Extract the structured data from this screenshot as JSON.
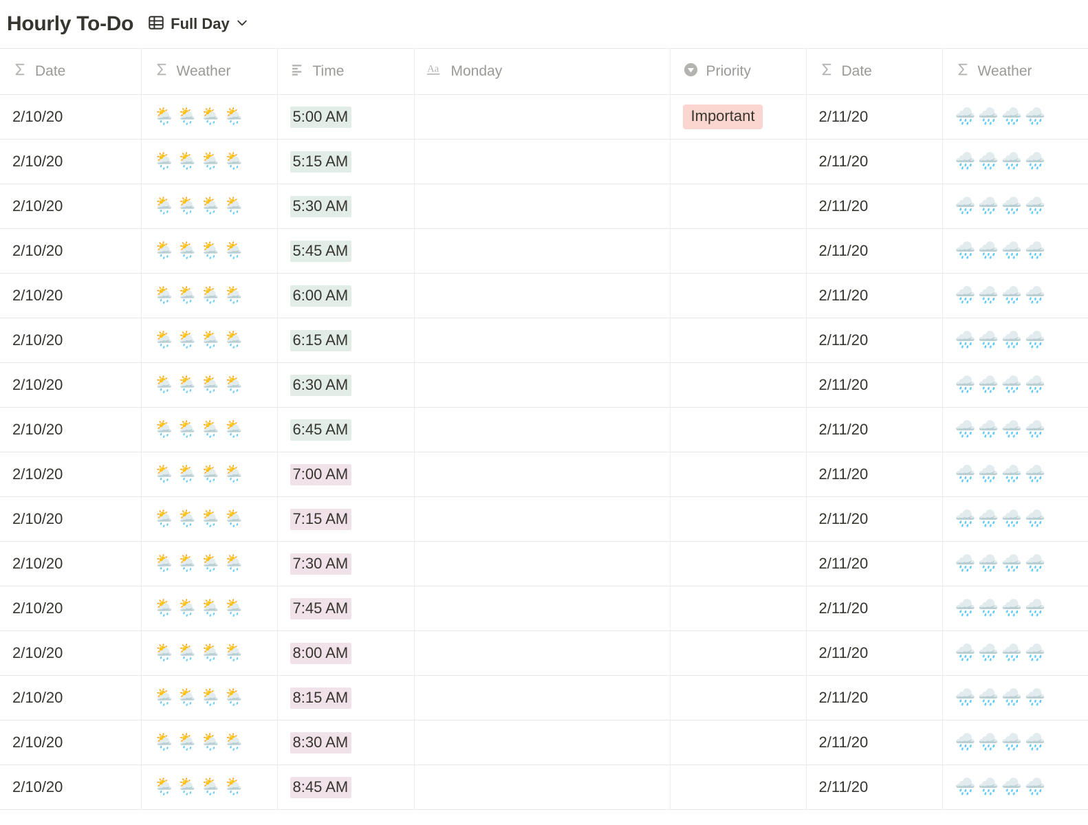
{
  "header": {
    "title": "Hourly To-Do",
    "view_icon": "table-icon",
    "view_label": "Full Day",
    "chevron_icon": "chevron-down-icon"
  },
  "table": {
    "columns": [
      {
        "id": "date_left",
        "label": "Date",
        "icon": "sigma-icon",
        "type": "formula"
      },
      {
        "id": "weather_left",
        "label": "Weather",
        "icon": "sigma-icon",
        "type": "formula"
      },
      {
        "id": "time",
        "label": "Time",
        "icon": "text-lines-icon",
        "type": "text"
      },
      {
        "id": "monday",
        "label": "Monday",
        "icon": "aa-icon",
        "type": "title"
      },
      {
        "id": "priority",
        "label": "Priority",
        "icon": "select-icon",
        "type": "select"
      },
      {
        "id": "date_right",
        "label": "Date",
        "icon": "sigma-icon",
        "type": "formula"
      },
      {
        "id": "weather_right",
        "label": "Weather",
        "icon": "sigma-icon",
        "type": "formula"
      }
    ],
    "highlight_colors": {
      "green": "#e2ede8",
      "pink": "#f1e2ea",
      "badge_important": "#fbd5d0"
    },
    "weather_glyphs": {
      "left": "🌦️🌦️🌦️🌦️",
      "right": "🌧️🌧️🌧️🌧️"
    },
    "rows": [
      {
        "date_left": "2/10/20",
        "weather_left": "🌦️🌦️🌦️🌦️",
        "time": "5:00 AM",
        "time_hl": "hl-green",
        "monday": "",
        "priority": "Important",
        "date_right": "2/11/20",
        "weather_right": "🌧️🌧️🌧️🌧️"
      },
      {
        "date_left": "2/10/20",
        "weather_left": "🌦️🌦️🌦️🌦️",
        "time": "5:15 AM",
        "time_hl": "hl-green",
        "monday": "",
        "priority": "",
        "date_right": "2/11/20",
        "weather_right": "🌧️🌧️🌧️🌧️"
      },
      {
        "date_left": "2/10/20",
        "weather_left": "🌦️🌦️🌦️🌦️",
        "time": "5:30 AM",
        "time_hl": "hl-green",
        "monday": "",
        "priority": "",
        "date_right": "2/11/20",
        "weather_right": "🌧️🌧️🌧️🌧️"
      },
      {
        "date_left": "2/10/20",
        "weather_left": "🌦️🌦️🌦️🌦️",
        "time": "5:45 AM",
        "time_hl": "hl-green",
        "monday": "",
        "priority": "",
        "date_right": "2/11/20",
        "weather_right": "🌧️🌧️🌧️🌧️"
      },
      {
        "date_left": "2/10/20",
        "weather_left": "🌦️🌦️🌦️🌦️",
        "time": "6:00 AM",
        "time_hl": "hl-green",
        "monday": "",
        "priority": "",
        "date_right": "2/11/20",
        "weather_right": "🌧️🌧️🌧️🌧️"
      },
      {
        "date_left": "2/10/20",
        "weather_left": "🌦️🌦️🌦️🌦️",
        "time": "6:15 AM",
        "time_hl": "hl-green",
        "monday": "",
        "priority": "",
        "date_right": "2/11/20",
        "weather_right": "🌧️🌧️🌧️🌧️"
      },
      {
        "date_left": "2/10/20",
        "weather_left": "🌦️🌦️🌦️🌦️",
        "time": "6:30 AM",
        "time_hl": "hl-green",
        "monday": "",
        "priority": "",
        "date_right": "2/11/20",
        "weather_right": "🌧️🌧️🌧️🌧️"
      },
      {
        "date_left": "2/10/20",
        "weather_left": "🌦️🌦️🌦️🌦️",
        "time": "6:45 AM",
        "time_hl": "hl-green",
        "monday": "",
        "priority": "",
        "date_right": "2/11/20",
        "weather_right": "🌧️🌧️🌧️🌧️"
      },
      {
        "date_left": "2/10/20",
        "weather_left": "🌦️🌦️🌦️🌦️",
        "time": "7:00 AM",
        "time_hl": "hl-pink",
        "monday": "",
        "priority": "",
        "date_right": "2/11/20",
        "weather_right": "🌧️🌧️🌧️🌧️"
      },
      {
        "date_left": "2/10/20",
        "weather_left": "🌦️🌦️🌦️🌦️",
        "time": "7:15 AM",
        "time_hl": "hl-pink",
        "monday": "",
        "priority": "",
        "date_right": "2/11/20",
        "weather_right": "🌧️🌧️🌧️🌧️"
      },
      {
        "date_left": "2/10/20",
        "weather_left": "🌦️🌦️🌦️🌦️",
        "time": "7:30 AM",
        "time_hl": "hl-pink",
        "monday": "",
        "priority": "",
        "date_right": "2/11/20",
        "weather_right": "🌧️🌧️🌧️🌧️"
      },
      {
        "date_left": "2/10/20",
        "weather_left": "🌦️🌦️🌦️🌦️",
        "time": "7:45 AM",
        "time_hl": "hl-pink",
        "monday": "",
        "priority": "",
        "date_right": "2/11/20",
        "weather_right": "🌧️🌧️🌧️🌧️"
      },
      {
        "date_left": "2/10/20",
        "weather_left": "🌦️🌦️🌦️🌦️",
        "time": "8:00 AM",
        "time_hl": "hl-pink",
        "monday": "",
        "priority": "",
        "date_right": "2/11/20",
        "weather_right": "🌧️🌧️🌧️🌧️"
      },
      {
        "date_left": "2/10/20",
        "weather_left": "🌦️🌦️🌦️🌦️",
        "time": "8:15 AM",
        "time_hl": "hl-pink",
        "monday": "",
        "priority": "",
        "date_right": "2/11/20",
        "weather_right": "🌧️🌧️🌧️🌧️"
      },
      {
        "date_left": "2/10/20",
        "weather_left": "🌦️🌦️🌦️🌦️",
        "time": "8:30 AM",
        "time_hl": "hl-pink",
        "monday": "",
        "priority": "",
        "date_right": "2/11/20",
        "weather_right": "🌧️🌧️🌧️🌧️"
      },
      {
        "date_left": "2/10/20",
        "weather_left": "🌦️🌦️🌦️🌦️",
        "time": "8:45 AM",
        "time_hl": "hl-pink",
        "monday": "",
        "priority": "",
        "date_right": "2/11/20",
        "weather_right": "🌧️🌧️🌧️🌧️"
      }
    ]
  }
}
